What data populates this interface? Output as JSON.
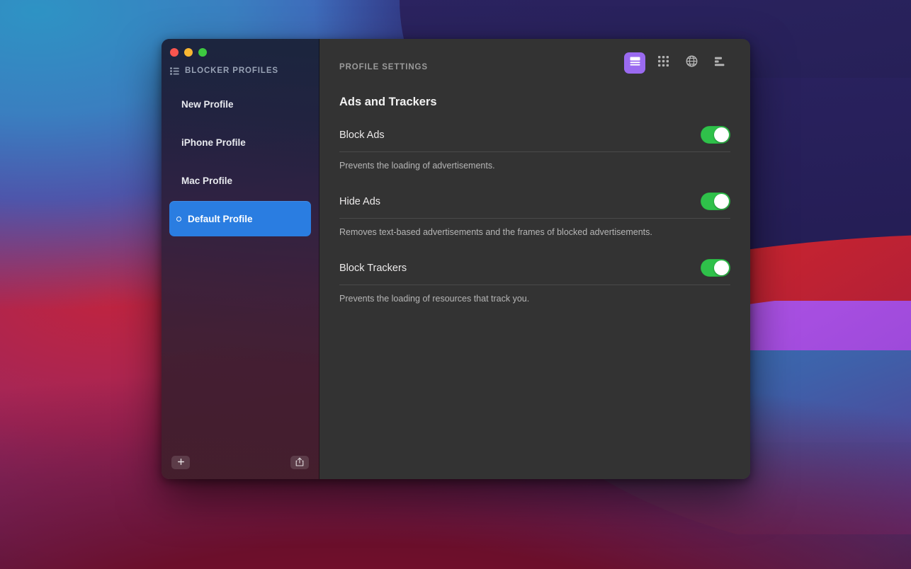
{
  "window": {
    "traffic_lights": [
      {
        "name": "close",
        "color": "#f9554f"
      },
      {
        "name": "minimize",
        "color": "#f9b732"
      },
      {
        "name": "zoom",
        "color": "#3dc940"
      }
    ]
  },
  "sidebar": {
    "header_title": "BLOCKER PROFILES",
    "header_icon": "list-icon",
    "items": [
      {
        "label": "New Profile",
        "selected": false
      },
      {
        "label": "iPhone Profile",
        "selected": false
      },
      {
        "label": "Mac Profile",
        "selected": false
      },
      {
        "label": "Default Profile",
        "selected": true
      }
    ],
    "selected_accent": "#2a7de1",
    "footer": {
      "add_label": "+",
      "add_icon": "plus-icon",
      "share_icon": "share-export-icon"
    }
  },
  "content": {
    "eyebrow": "PROFILE SETTINGS",
    "title": "Ads and Trackers",
    "toolbar": [
      {
        "icon": "article-view-icon",
        "active": true,
        "accent": "#9a6af0"
      },
      {
        "icon": "grid-dots-icon",
        "active": false
      },
      {
        "icon": "globe-icon",
        "active": false
      },
      {
        "icon": "bars-list-icon",
        "active": false
      }
    ],
    "settings": [
      {
        "label": "Block Ads",
        "description": "Prevents the loading of advertisements.",
        "enabled": true
      },
      {
        "label": "Hide Ads",
        "description": "Removes text-based advertisements and the frames of blocked advertisements.",
        "enabled": true
      },
      {
        "label": "Block Trackers",
        "description": "Prevents the loading of resources that track you.",
        "enabled": true
      }
    ],
    "toggle_on_color": "#2fc14a"
  }
}
